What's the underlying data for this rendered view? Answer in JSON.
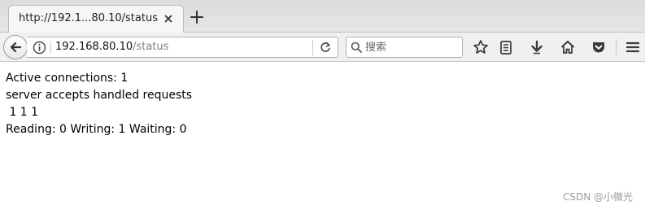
{
  "tab": {
    "title": "http://192.1...80.10/status"
  },
  "urlbar": {
    "host": "192.168.80.10",
    "path": "/status"
  },
  "search": {
    "placeholder": "搜索"
  },
  "toolbar": {
    "icons": [
      "bookmark-star-icon",
      "reading-list-icon",
      "downloads-icon",
      "home-icon",
      "pocket-icon",
      "menu-icon"
    ]
  },
  "page": {
    "lines": [
      "Active connections: 1",
      "server accepts handled requests",
      " 1 1 1",
      "Reading: 0 Writing: 1 Waiting: 0"
    ]
  },
  "watermark": "CSDN @小微光",
  "colors": {
    "accent": "#3d7fd6",
    "text": "#000000",
    "tab_bg": "#f6f6f6"
  }
}
